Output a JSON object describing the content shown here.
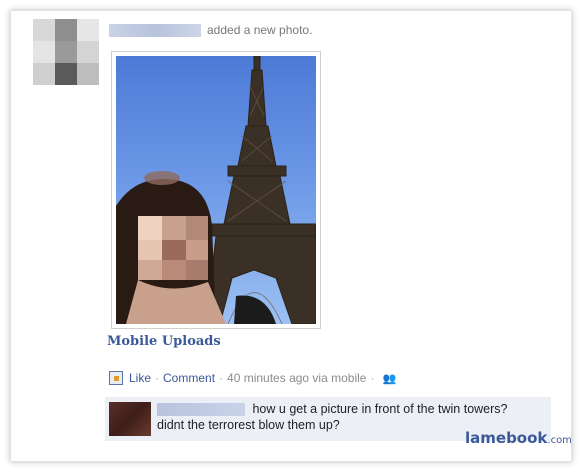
{
  "story": {
    "action_text": "added a new photo.",
    "album_link": "Mobile Uploads"
  },
  "actions": {
    "like": "Like",
    "comment": "Comment",
    "timestamp": "40 minutes ago via mobile",
    "sep": "·",
    "like_icon": "like-thumb-icon",
    "audience_icon": "friends-icon"
  },
  "comment": {
    "line1": "how u get a picture in front of the twin towers?",
    "line2": "didnt the terrorest blow them up?"
  },
  "watermark": {
    "brand": "lamebook",
    "tld": ".com"
  },
  "colors": {
    "link": "#3b5998",
    "meta_gray": "#8c8c8c",
    "comment_bg": "#eceff5"
  }
}
